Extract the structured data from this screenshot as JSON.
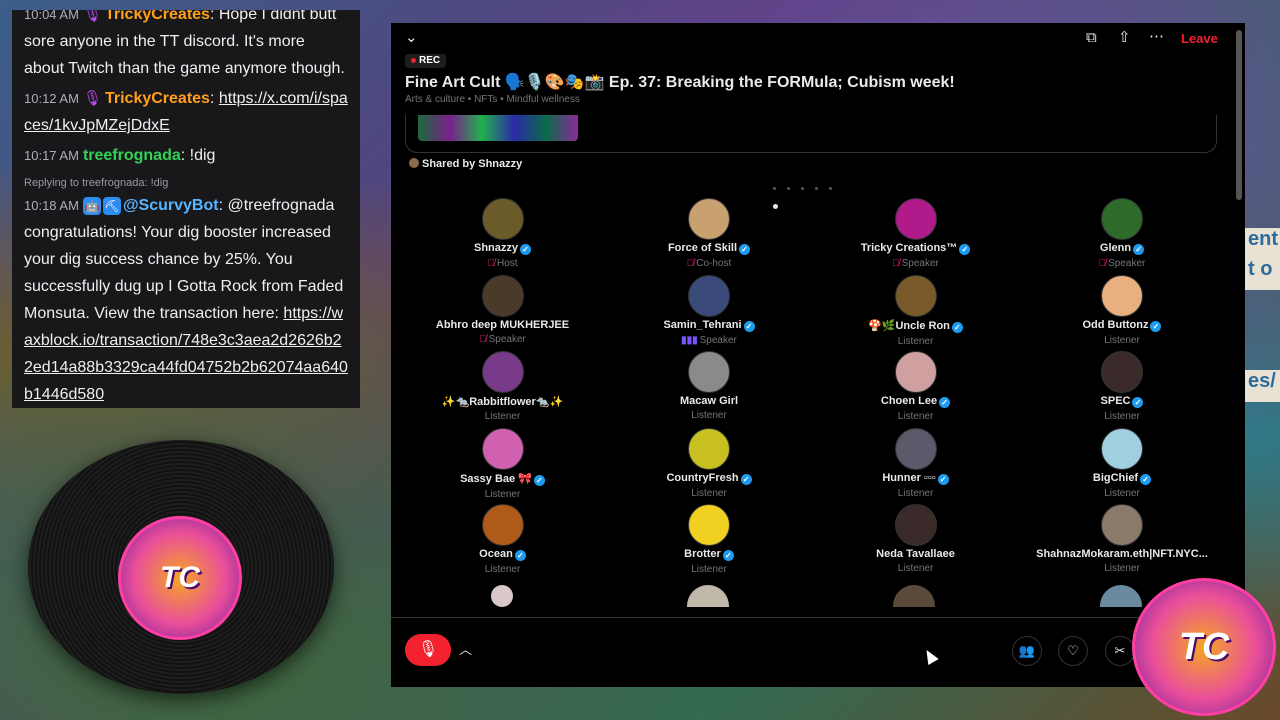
{
  "chat": {
    "messages": [
      {
        "time": "10:04 AM",
        "nick": "TrickyCreates",
        "text": ": Hope I didnt butt sore anyone in the TT discord. It's more about Twitch than the game anymore though."
      },
      {
        "time": "10:12 AM",
        "nick": "TrickyCreates",
        "text": ":",
        "link": "https://x.com/i/spaces/1kvJpMZejDdxE"
      },
      {
        "time": "10:17 AM",
        "nick": "treefrognada",
        "text": ": !dig"
      },
      {
        "reply": "Replying to treefrognada: !dig",
        "time": "10:18 AM",
        "nick": "@ScurvyBot",
        "text": ": @treefrognada congratulations! Your dig booster increased your dig success chance by 25%. You successfully dug up I Gotta Rock from Faded Monsuta. View the transaction here:",
        "link": "https://waxblock.io/transaction/748e3c3aea2d2626b22ed14a88b3329ca44fd04752b2b62074aa640b1446d580"
      }
    ]
  },
  "logo": {
    "text": "TC"
  },
  "space": {
    "leave_label": "Leave",
    "rec_label": "REC",
    "title": "Fine Art Cult 🗣️🎙️🎨🎭📸 Ep. 37: Breaking the FORMula; Cubism week!",
    "subtitle": "Arts & culture • NFTs • Mindful wellness",
    "shared_by": "Shared by Shnazzy",
    "participants": [
      {
        "name": "Shnazzy",
        "verified": true,
        "role": "Host",
        "role_icon": "muted",
        "color": "#6b5a2a"
      },
      {
        "name": "Force of Skill",
        "verified": true,
        "role": "Co-host",
        "role_icon": "muted",
        "color": "#c9a070"
      },
      {
        "name": "Tricky Creations™",
        "verified": true,
        "role": "Speaker",
        "role_icon": "muted",
        "color": "#b01a8a"
      },
      {
        "name": "Glenn",
        "verified": true,
        "role": "Speaker",
        "role_icon": "muted",
        "color": "#2e6a2a"
      },
      {
        "name": "Abhro deep MUKHERJEE",
        "verified": false,
        "role": "Speaker",
        "role_icon": "muted",
        "color": "#4a3a2a"
      },
      {
        "name": "Samin_Tehrani",
        "verified": true,
        "role": "Speaker",
        "role_icon": "wave",
        "color": "#3a4a7a"
      },
      {
        "name": "🍄🌿Uncle Ron",
        "verified": true,
        "role": "Listener",
        "role_icon": "",
        "color": "#7a5a2a"
      },
      {
        "name": "Odd Buttonz",
        "verified": true,
        "role": "Listener",
        "role_icon": "",
        "color": "#e8b080"
      },
      {
        "name": "✨🐀Rabbitflower🐀✨",
        "verified": false,
        "role": "Listener",
        "role_icon": "",
        "color": "#7a3a8a"
      },
      {
        "name": "Macaw Girl",
        "verified": false,
        "role": "Listener",
        "role_icon": "",
        "color": "#8a8a8a"
      },
      {
        "name": "Choen Lee",
        "verified": true,
        "role": "Listener",
        "role_icon": "",
        "color": "#d0a0a0"
      },
      {
        "name": "SPEC",
        "verified": true,
        "role": "Listener",
        "role_icon": "",
        "color": "#3a2a2a"
      },
      {
        "name": "Sassy Bae 🎀",
        "verified": true,
        "role": "Listener",
        "role_icon": "",
        "color": "#d060b0"
      },
      {
        "name": "CountryFresh",
        "verified": true,
        "role": "Listener",
        "role_icon": "",
        "color": "#c8c020"
      },
      {
        "name": "Hunner ▫▫▫",
        "verified": true,
        "role": "Listener",
        "role_icon": "",
        "color": "#5a5a6a"
      },
      {
        "name": "BigChief",
        "verified": true,
        "role": "Listener",
        "role_icon": "",
        "color": "#a0d0e0"
      },
      {
        "name": "Ocean",
        "verified": true,
        "role": "Listener",
        "role_icon": "",
        "color": "#b05a1a"
      },
      {
        "name": "Brotter",
        "verified": true,
        "role": "Listener",
        "role_icon": "",
        "color": "#f0d020"
      },
      {
        "name": "Neda Tavallaee",
        "verified": false,
        "role": "Listener",
        "role_icon": "",
        "color": "#3a2a2a"
      },
      {
        "name": "ShahnazMokaram.eth|NFT.NYC...",
        "verified": false,
        "role": "Listener",
        "role_icon": "",
        "color": "#8a7a6a"
      }
    ]
  },
  "bg_fragments": [
    "ent",
    "t o",
    "es/"
  ]
}
